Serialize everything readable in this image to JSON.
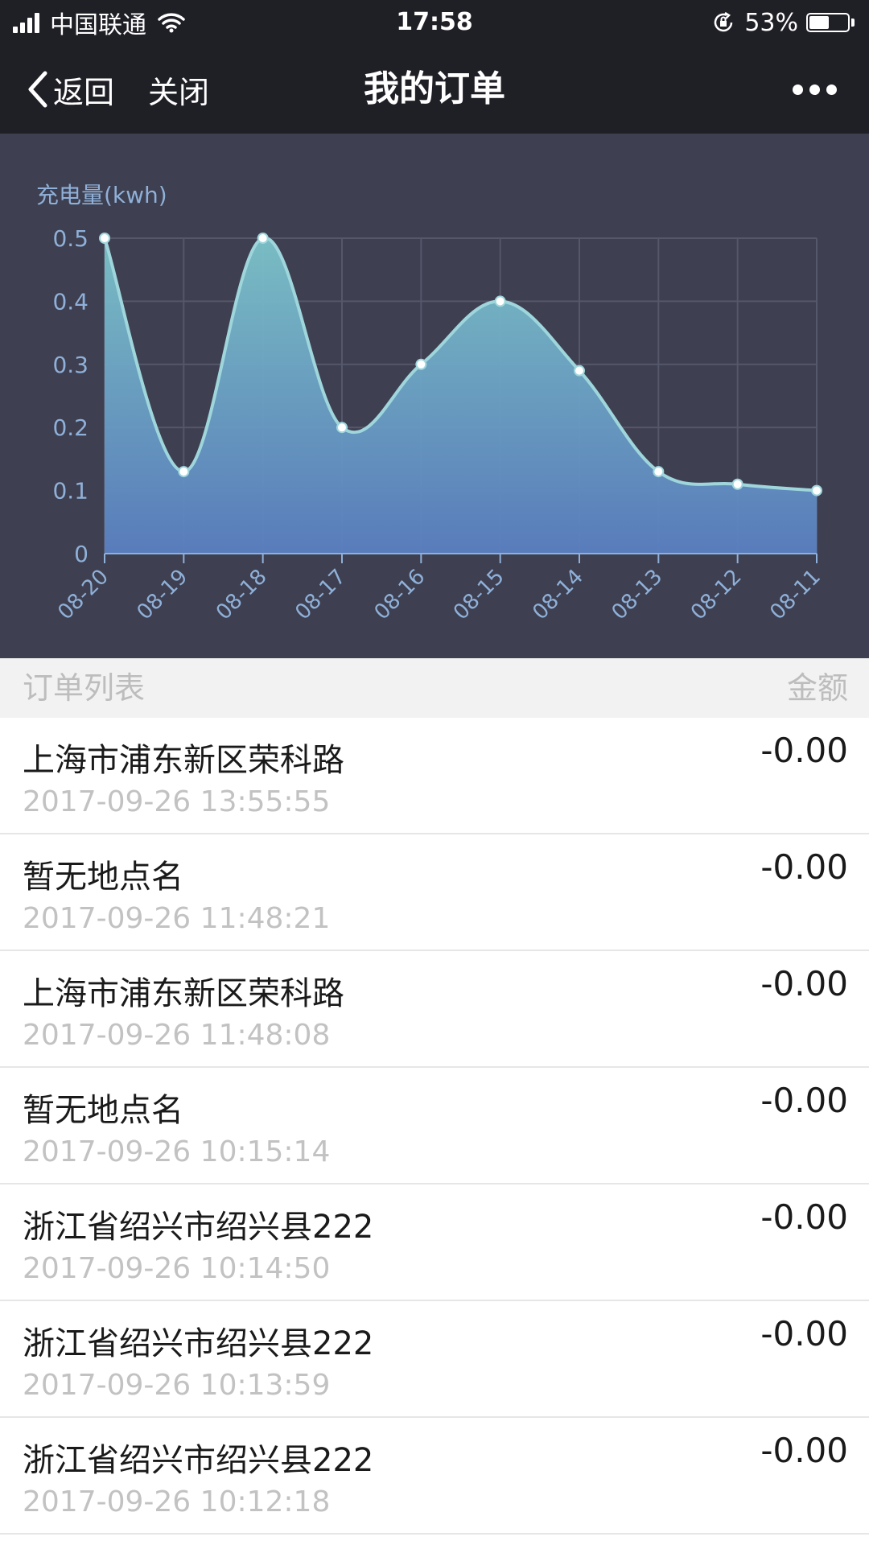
{
  "status_bar": {
    "carrier": "中国联通",
    "time": "17:58",
    "battery": "53%",
    "battery_level": 0.53
  },
  "nav": {
    "back_label": "返回",
    "close_label": "关闭",
    "title": "我的订单"
  },
  "chart_data": {
    "type": "area",
    "ylabel": "充电量(kwh)",
    "categories": [
      "08-20",
      "08-19",
      "08-18",
      "08-17",
      "08-16",
      "08-15",
      "08-14",
      "08-13",
      "08-12",
      "08-11"
    ],
    "values": [
      0.5,
      0.13,
      0.5,
      0.2,
      0.3,
      0.4,
      0.29,
      0.13,
      0.11,
      0.1
    ],
    "ylim": [
      0,
      0.5
    ],
    "yticks": [
      "0",
      "0.1",
      "0.2",
      "0.3",
      "0.4",
      "0.5"
    ],
    "grid": true,
    "colors": {
      "line": "#9fd6dc",
      "fill_top": "#7cc3c9",
      "fill_bottom": "#5a7fc0",
      "label": "#8fb0d8",
      "grid": "#55576a"
    }
  },
  "list_header": {
    "left": "订单列表",
    "right": "金额"
  },
  "orders": [
    {
      "name": "上海市浦东新区荣科路",
      "time": "2017-09-26 13:55:55",
      "amount": "-0.00"
    },
    {
      "name": "暂无地点名",
      "time": "2017-09-26 11:48:21",
      "amount": "-0.00"
    },
    {
      "name": "上海市浦东新区荣科路",
      "time": "2017-09-26 11:48:08",
      "amount": "-0.00"
    },
    {
      "name": "暂无地点名",
      "time": "2017-09-26 10:15:14",
      "amount": "-0.00"
    },
    {
      "name": "浙江省绍兴市绍兴县222",
      "time": "2017-09-26 10:14:50",
      "amount": "-0.00"
    },
    {
      "name": "浙江省绍兴市绍兴县222",
      "time": "2017-09-26 10:13:59",
      "amount": "-0.00"
    },
    {
      "name": "浙江省绍兴市绍兴县222",
      "time": "2017-09-26 10:12:18",
      "amount": "-0.00"
    }
  ]
}
